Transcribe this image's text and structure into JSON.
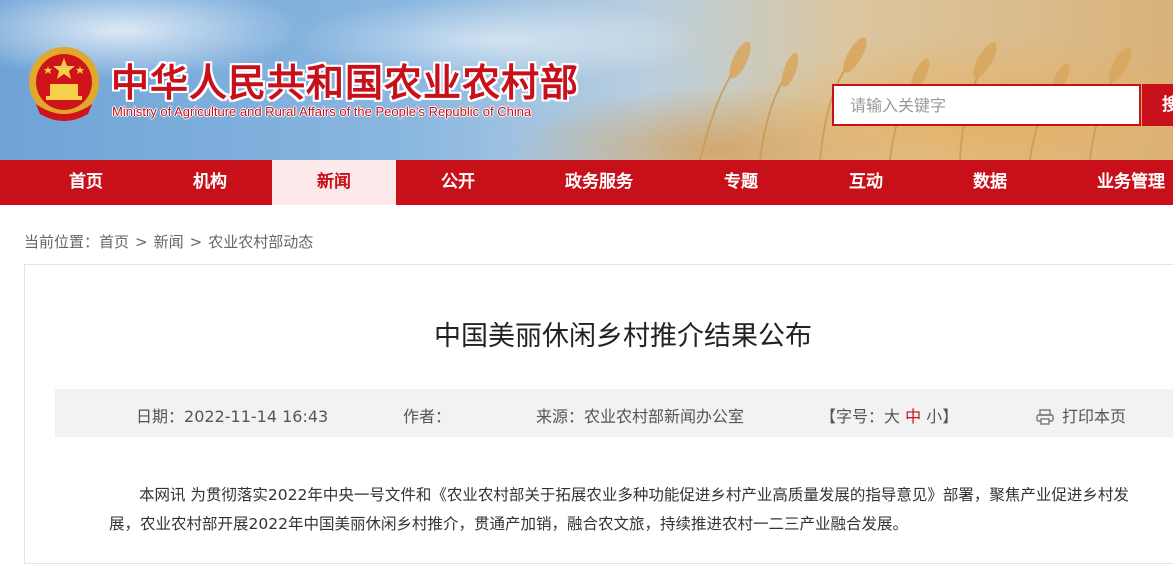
{
  "header": {
    "site_title_cn": "中华人民共和国农业农村部",
    "site_title_en": "Ministry of Agriculture and Rural Affairs of the People's Republic of China",
    "search_placeholder": "请输入关键字",
    "search_button": "搜"
  },
  "nav": {
    "items": [
      {
        "label": "首页"
      },
      {
        "label": "机构"
      },
      {
        "label": "新闻"
      },
      {
        "label": "公开"
      },
      {
        "label": "政务服务"
      },
      {
        "label": "专题"
      },
      {
        "label": "互动"
      },
      {
        "label": "数据"
      },
      {
        "label": "业务管理"
      }
    ],
    "active": "新闻"
  },
  "breadcrumb": {
    "prefix": "当前位置：",
    "items": [
      "首页",
      "新闻",
      "农业农村部动态"
    ],
    "separator": ">"
  },
  "article": {
    "title": "中国美丽休闲乡村推介结果公布",
    "meta": {
      "date_label": "日期：",
      "date_value": "2022-11-14 16:43",
      "author_label": "作者：",
      "author_value": "",
      "source_label": "来源：",
      "source_value": "农业农村部新闻办公室",
      "font_size_open": "【字号：",
      "font_large": "大",
      "font_medium": "中",
      "font_small": "小",
      "font_size_close": "】",
      "print_label": "打印本页"
    },
    "body": "本网讯 为贯彻落实2022年中央一号文件和《农业农村部关于拓展农业多种功能促进乡村产业高质量发展的指导意见》部署，聚焦产业促进乡村发展，农业农村部开展2022年中国美丽休闲乡村推介，贯通产加销，融合农文旅，持续推进农村一二三产业融合发展。"
  },
  "colors": {
    "brand_red": "#c8101a",
    "nav_active_bg": "#fde9e9",
    "meta_bar_bg": "#f2f2f2"
  }
}
